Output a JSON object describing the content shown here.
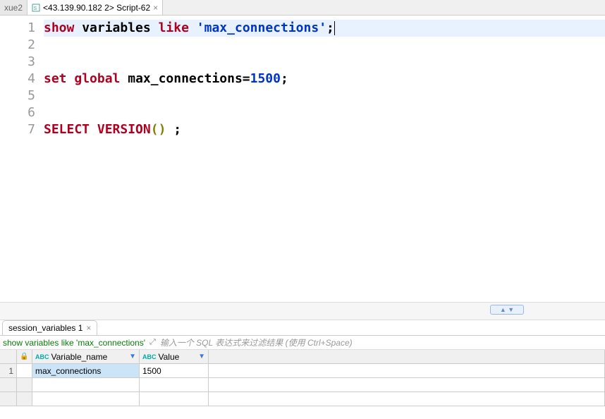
{
  "tabs": {
    "inactive": {
      "label": "xue2"
    },
    "active": {
      "label": "<43.139.90.182 2> Script-62"
    }
  },
  "editor": {
    "lines": [
      {
        "n": "1",
        "tokens": [
          {
            "t": "show",
            "c": "k-red"
          },
          {
            "t": " ",
            "c": ""
          },
          {
            "t": "variables",
            "c": "k-plain"
          },
          {
            "t": " ",
            "c": ""
          },
          {
            "t": "like",
            "c": "k-red"
          },
          {
            "t": " ",
            "c": ""
          },
          {
            "t": "'max_connections'",
            "c": "k-str"
          },
          {
            "t": ";",
            "c": "k-plain"
          }
        ],
        "hl": true,
        "cursor": true
      },
      {
        "n": "2",
        "tokens": [],
        "hl": false
      },
      {
        "n": "3",
        "tokens": [],
        "hl": false
      },
      {
        "n": "4",
        "tokens": [
          {
            "t": "set",
            "c": "k-red"
          },
          {
            "t": " ",
            "c": ""
          },
          {
            "t": "global",
            "c": "k-red"
          },
          {
            "t": " ",
            "c": ""
          },
          {
            "t": "max_connections=",
            "c": "k-plain"
          },
          {
            "t": "1500",
            "c": "k-num"
          },
          {
            "t": ";",
            "c": "k-plain"
          }
        ],
        "hl": false
      },
      {
        "n": "5",
        "tokens": [],
        "hl": false
      },
      {
        "n": "6",
        "tokens": [],
        "hl": false
      },
      {
        "n": "7",
        "tokens": [
          {
            "t": "SELECT",
            "c": "k-red"
          },
          {
            "t": " ",
            "c": ""
          },
          {
            "t": "VERSION",
            "c": "k-red"
          },
          {
            "t": "()",
            "c": "k-olive"
          },
          {
            "t": " ",
            "c": ""
          },
          {
            "t": ";",
            "c": "k-plain"
          }
        ],
        "hl": false
      }
    ]
  },
  "results": {
    "tab_label": "session_variables 1",
    "sql_text": "show variables like 'max_connections'",
    "filter_hint": "输入一个 SQL 表达式来过滤结果 (使用 Ctrl+Space)",
    "columns": {
      "name": "Variable_name",
      "value": "Value"
    },
    "rows": [
      {
        "n": "1",
        "name": "max_connections",
        "value": "1500"
      }
    ]
  }
}
